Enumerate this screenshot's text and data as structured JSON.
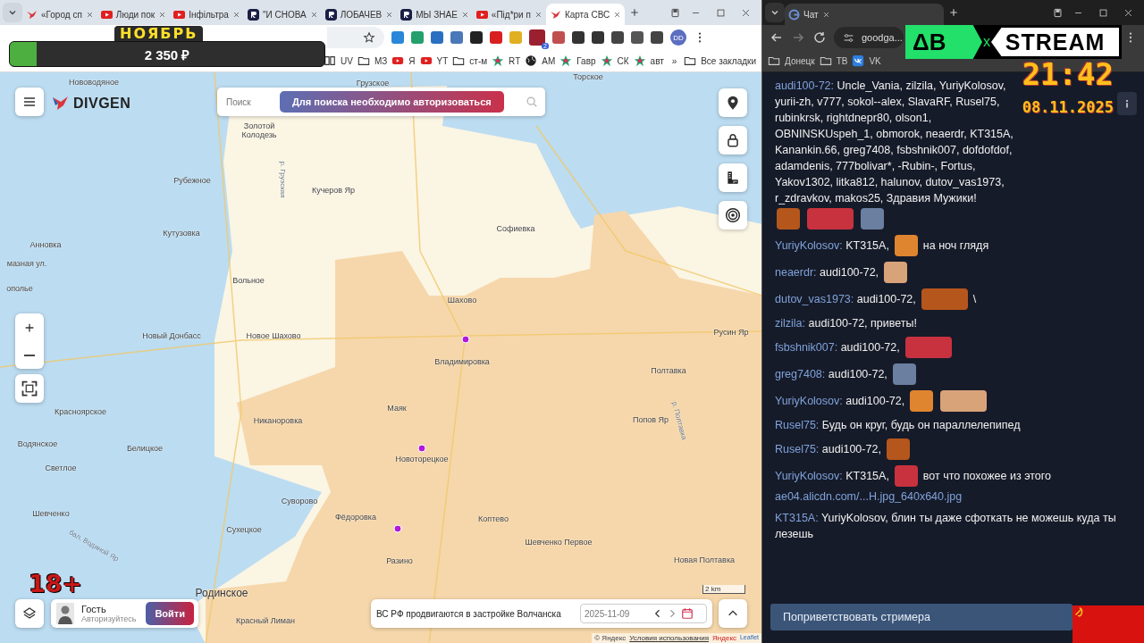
{
  "left_browser": {
    "tabs": [
      {
        "kind": "site",
        "title": "«Город сп",
        "selected": false
      },
      {
        "kind": "youtube",
        "title": "Люди пок",
        "selected": false
      },
      {
        "kind": "youtube",
        "title": "Інфільтра",
        "selected": false
      },
      {
        "kind": "r",
        "title": "\"И СНОВА",
        "selected": false
      },
      {
        "kind": "r",
        "title": "ЛОБАЧЕВ",
        "selected": false
      },
      {
        "kind": "r",
        "title": "МЫ ЗНАЕ",
        "selected": false
      },
      {
        "kind": "youtube",
        "title": "«Під*ри п",
        "selected": false
      },
      {
        "kind": "site",
        "title": "Карта СВС",
        "selected": true
      }
    ],
    "bookmarks": [
      {
        "kind": "book",
        "label": "UV"
      },
      {
        "kind": "folder",
        "label": "МЗ"
      },
      {
        "kind": "youtube",
        "label": "Я"
      },
      {
        "kind": "youtube",
        "label": "YT"
      },
      {
        "kind": "folder",
        "label": "ст-м"
      },
      {
        "kind": "star",
        "label": "RT"
      },
      {
        "kind": "globe",
        "label": "АМ"
      },
      {
        "kind": "star",
        "label": "Гавр"
      },
      {
        "kind": "star",
        "label": "СК"
      },
      {
        "kind": "star",
        "label": "авт"
      }
    ],
    "more_bookmarks": "»",
    "all_bookmarks": "Все закладки",
    "extension_badge": "2",
    "profile": "DD"
  },
  "map": {
    "logo": "DIVGEN",
    "search_placeholder": "Поиск",
    "auth_notice": "Для поиска необходимо авторизоваться",
    "labels": [
      {
        "kind": "town",
        "text": "Нововодяное"
      },
      {
        "kind": "town",
        "text": "Грузское"
      },
      {
        "kind": "town",
        "text": "Торское"
      },
      {
        "kind": "town",
        "text": "Золотой Колодезь"
      },
      {
        "kind": "town",
        "text": "Рубежное"
      },
      {
        "kind": "town",
        "text": "Кучеров Яр"
      },
      {
        "kind": "town",
        "text": "Кутузовка"
      },
      {
        "kind": "town",
        "text": "Анновка"
      },
      {
        "kind": "town",
        "text": "Софиевка"
      },
      {
        "kind": "street",
        "text": "мазная ул."
      },
      {
        "kind": "town",
        "text": "ополье"
      },
      {
        "kind": "town",
        "text": "Вольное"
      },
      {
        "kind": "town",
        "text": "Шахово"
      },
      {
        "kind": "town",
        "text": "Новый Донбасс"
      },
      {
        "kind": "town",
        "text": "Новое Шахово"
      },
      {
        "kind": "town",
        "text": "Русин Яр"
      },
      {
        "kind": "town",
        "text": "Владимировка"
      },
      {
        "kind": "town",
        "text": "Полтавка"
      },
      {
        "kind": "town",
        "text": "Маяк"
      },
      {
        "kind": "town",
        "text": "Красноярское"
      },
      {
        "kind": "town",
        "text": "Никаноровка"
      },
      {
        "kind": "town",
        "text": "Попов Яр"
      },
      {
        "kind": "town",
        "text": "Водянское"
      },
      {
        "kind": "town",
        "text": "Белицкое"
      },
      {
        "kind": "town",
        "text": "Новоторецкое"
      },
      {
        "kind": "town",
        "text": "Светлое"
      },
      {
        "kind": "town",
        "text": "Суворово"
      },
      {
        "kind": "town",
        "text": "Шевченко"
      },
      {
        "kind": "town",
        "text": "Фёдоровка"
      },
      {
        "kind": "town",
        "text": "Коптево"
      },
      {
        "kind": "town",
        "text": "Сухецкое"
      },
      {
        "kind": "town",
        "text": "Шевченко Первое"
      },
      {
        "kind": "town",
        "text": "Разино"
      },
      {
        "kind": "town",
        "text": "Новая Полтавка"
      },
      {
        "kind": "city",
        "text": "Родинское"
      },
      {
        "kind": "town",
        "text": "Красный Лиман"
      },
      {
        "kind": "river",
        "text": "р. Грузская"
      },
      {
        "kind": "river",
        "text": "р. Полтавка"
      },
      {
        "kind": "river",
        "text": "бал. Водяной Яр"
      }
    ],
    "user": {
      "name": "Гость",
      "status": "Авторизуйтесь",
      "login": "Войти"
    },
    "news": "ВС РФ продвигаются в застройке Волчанска",
    "date": "2025-11-09",
    "scale": "2 km",
    "attribution": {
      "copyright": "© Яндекс",
      "terms": "Условия использования",
      "provider": "Яндекс",
      "engine": "Leaflet"
    }
  },
  "right_browser": {
    "tabs": [
      {
        "kind": "g",
        "title": "Чат",
        "selected": true
      }
    ],
    "address": "goodga...",
    "bookmarks": [
      {
        "kind": "folder",
        "label": "Донецк"
      },
      {
        "kind": "folder",
        "label": "ТВ"
      },
      {
        "kind": "vk",
        "label": "VK"
      }
    ]
  },
  "chat": {
    "messages": [
      {
        "user": "audi100-72:",
        "parts": [
          {
            "kind": "text",
            "text": "Uncle_Vania, zilzila, YuriyKolosov, yurii-zh, v777, sokol--alex, SlavaRF, Rusel75, rubinkrsk, rightdnepr80, olson1"
          },
          {
            "kind": "text",
            "text": ", OBNINSKUspeh_1, obmorok, neaerdr, KT315A, Kanankin.66, greg7408, fsbshnik007, dofdofdof, adamdenis, 777bolivar*, -Rubin-, Fortus, Yakov1302, litka812, halunov, dutov_vas1973, r_zdravkov, makos25, Здравия Мужики!"
          },
          {
            "kind": "emote"
          },
          {
            "kind": "emote_wide"
          },
          {
            "kind": "emote"
          }
        ]
      },
      {
        "user": "YuriyKolosov:",
        "parts": [
          {
            "kind": "text",
            "text": "KT315A,"
          },
          {
            "kind": "emote"
          },
          {
            "kind": "text",
            "text": "на ноч глядя"
          }
        ]
      },
      {
        "user": "neaerdr:",
        "parts": [
          {
            "kind": "text",
            "text": "audi100-72,"
          },
          {
            "kind": "emote"
          }
        ]
      },
      {
        "user": "dutov_vas1973:",
        "parts": [
          {
            "kind": "text",
            "text": "audi100-72,"
          },
          {
            "kind": "emote_wide"
          },
          {
            "kind": "text",
            "text": "\\"
          }
        ]
      },
      {
        "user": "zilzila:",
        "parts": [
          {
            "kind": "text",
            "text": "audi100-72, приветы!"
          }
        ]
      },
      {
        "user": "fsbshnik007:",
        "parts": [
          {
            "kind": "text",
            "text": "audi100-72,"
          },
          {
            "kind": "emote_wide"
          }
        ]
      },
      {
        "user": "greg7408:",
        "parts": [
          {
            "kind": "text",
            "text": "audi100-72,"
          },
          {
            "kind": "emote"
          }
        ]
      },
      {
        "user": "YuriyKolosov:",
        "parts": [
          {
            "kind": "text",
            "text": "audi100-72,"
          },
          {
            "kind": "emote"
          },
          {
            "kind": "emote_wide"
          }
        ]
      },
      {
        "user": "Rusel75:",
        "parts": [
          {
            "kind": "text",
            "text": "Будь он круг, будь он параллелепипед"
          }
        ]
      },
      {
        "user": "Rusel75:",
        "parts": [
          {
            "kind": "text",
            "text": "audi100-72,"
          },
          {
            "kind": "emote"
          }
        ]
      },
      {
        "user": "YuriyKolosov:",
        "parts": [
          {
            "kind": "text",
            "text": "KT315A,"
          },
          {
            "kind": "emote"
          },
          {
            "kind": "text",
            "text": "вот что похожее из этого"
          },
          {
            "kind": "link",
            "text": "ae04.alicdn.com/...H.jpg_640x640.jpg"
          }
        ]
      },
      {
        "user": "KT315A:",
        "parts": [
          {
            "kind": "text",
            "text": "YuriyKolosov, блин ты даже сфоткать не можешь куда ты лезешь"
          }
        ]
      }
    ],
    "greet_button": "Поприветствовать стримера"
  },
  "overlay": {
    "month": "НОЯБРЬ",
    "goal": {
      "amount": "2 350 ₽",
      "level": 0.085
    },
    "logo": {
      "left": "ΔB",
      "separator": "x",
      "right": "STREAM"
    },
    "time": "21:42",
    "date": "08.11.2025",
    "age_rating": "18+"
  }
}
